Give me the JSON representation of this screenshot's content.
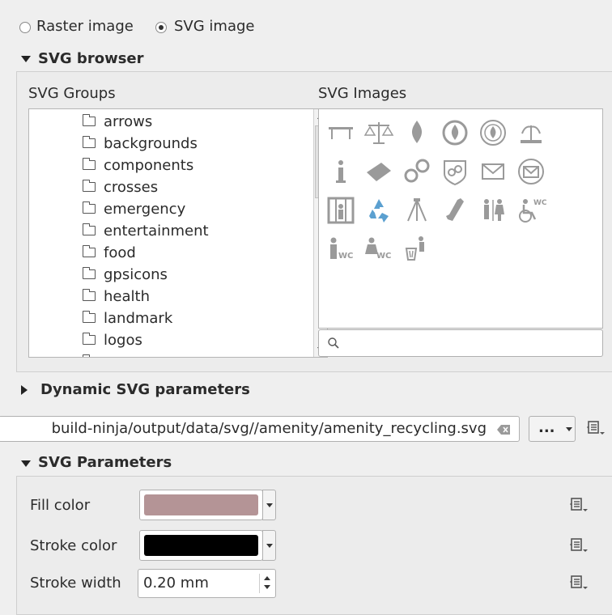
{
  "source_type": {
    "raster_label": "Raster image",
    "svg_label": "SVG image",
    "selected": "svg"
  },
  "svg_browser": {
    "title": "SVG browser",
    "groups_title": "SVG Groups",
    "images_title": "SVG Images",
    "groups": [
      "arrows",
      "backgrounds",
      "components",
      "crosses",
      "emergency",
      "entertainment",
      "food",
      "gpsicons",
      "health",
      "landmark",
      "logos",
      "money"
    ],
    "image_icons": [
      "table-icon",
      "scales-icon",
      "fire-icon",
      "fire-station-icon",
      "firefighter-badge-icon",
      "fountain-icon",
      "info-icon",
      "library-book-icon",
      "handcuffs-icon",
      "police-badge-icon",
      "post-box-icon",
      "post-office-icon",
      "prison-icon",
      "recycling-icon",
      "shelter-icon",
      "telephone-icon",
      "toilets-icon",
      "wheelchair-wc-icon",
      "male-wc-icon",
      "female-wc-icon",
      "waste-basket-icon"
    ],
    "search_placeholder": ""
  },
  "dynamic_params": {
    "title": "Dynamic SVG parameters"
  },
  "file_path": {
    "value": "build-ninja/output/data/svg//amenity/amenity_recycling.svg",
    "browse_label": "..."
  },
  "svg_params": {
    "title": "SVG Parameters",
    "fill_label": "Fill color",
    "fill_color": "#b49496",
    "stroke_label": "Stroke color",
    "stroke_color": "#000000",
    "stroke_width_label": "Stroke width",
    "stroke_width_value": "0.20 mm"
  }
}
